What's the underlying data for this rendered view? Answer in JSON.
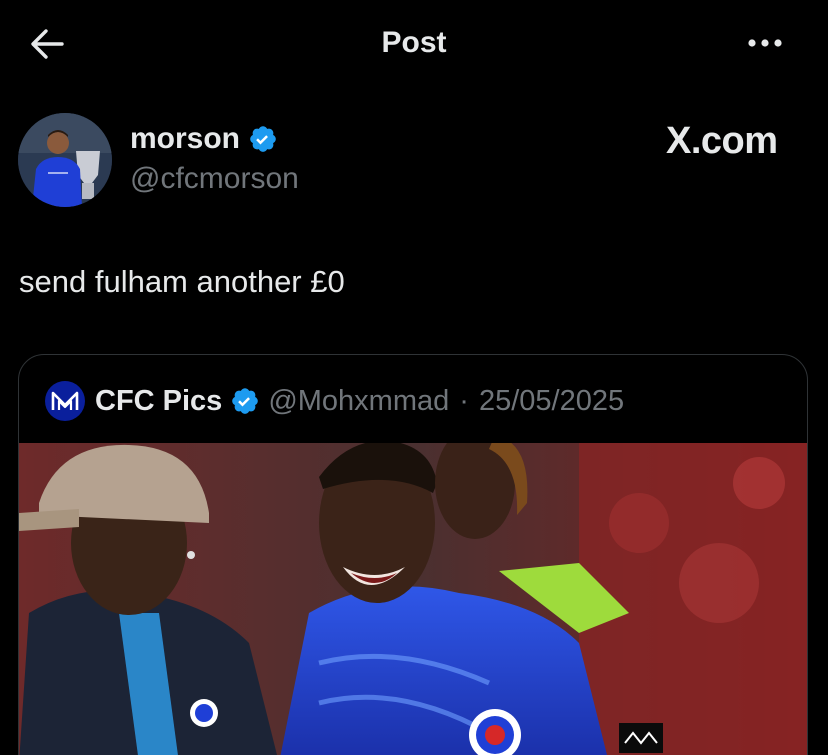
{
  "header": {
    "title": "Post",
    "back_icon": "back-arrow-icon",
    "more_icon": "more-horizontal-icon"
  },
  "author": {
    "display_name": "morson",
    "handle": "@cfcmorson",
    "verified": true
  },
  "watermark": {
    "text": "X.com"
  },
  "post": {
    "text": "send fulham another £0"
  },
  "quoted": {
    "display_name": "CFC Pics",
    "handle": "@Mohxmmad",
    "separator": "·",
    "date": "25/05/2025",
    "verified": true,
    "media_alt": "Chelsea players celebrating on the pitch"
  },
  "colors": {
    "background": "#000000",
    "text_primary": "#e7e9ea",
    "text_secondary": "#71767b",
    "verified_blue": "#1d9bf0",
    "border": "#2f3336",
    "chelsea_blue": "#1f3fd6"
  }
}
